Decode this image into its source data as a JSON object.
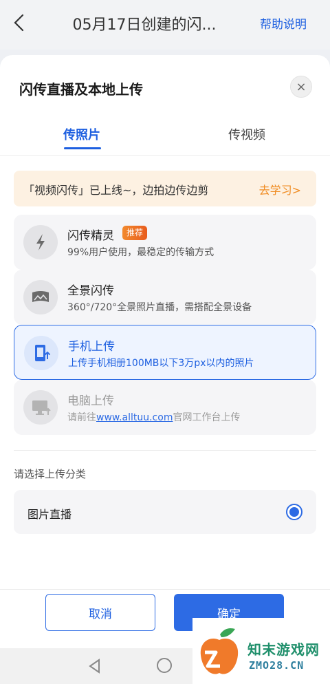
{
  "header": {
    "title": "05月17日创建的闪...",
    "help_label": "帮助说明"
  },
  "sheet": {
    "title": "闪传直播及本地上传",
    "close_label": "×",
    "tabs": [
      {
        "label": "传照片",
        "active": true
      },
      {
        "label": "传视频",
        "active": false
      }
    ],
    "banner": {
      "text": "「视频闪传」已上线~，边拍边传边剪",
      "link": "去学习>"
    },
    "options": [
      {
        "title": "闪传精灵",
        "badge": "推荐",
        "desc": "99%用户使用，最稳定的传输方式",
        "icon": "lightning-icon",
        "state": "normal"
      },
      {
        "title": "全景闪传",
        "desc": "360°/720°全景照片直播，需搭配全景设备",
        "icon": "panorama-icon",
        "state": "normal"
      },
      {
        "title": "手机上传",
        "desc": "上传手机相册100MB以下3万px以内的照片",
        "icon": "phone-upload-icon",
        "state": "selected"
      },
      {
        "title": "电脑上传",
        "desc_prefix": "请前往",
        "desc_link": "www.alltuu.com",
        "desc_suffix": "官网工作台上传",
        "icon": "computer-upload-icon",
        "state": "disabled"
      }
    ],
    "category_label": "请选择上传分类",
    "category": {
      "label": "图片直播",
      "selected": true
    },
    "cancel_label": "取消",
    "confirm_label": "确定"
  },
  "watermark": {
    "name": "知末游戏网",
    "url": "ZMO28.CN"
  },
  "colors": {
    "accent": "#2d6be4",
    "banner_bg": "#fdf1e2",
    "banner_link": "#f08c22",
    "badge": "#e85c1d"
  }
}
